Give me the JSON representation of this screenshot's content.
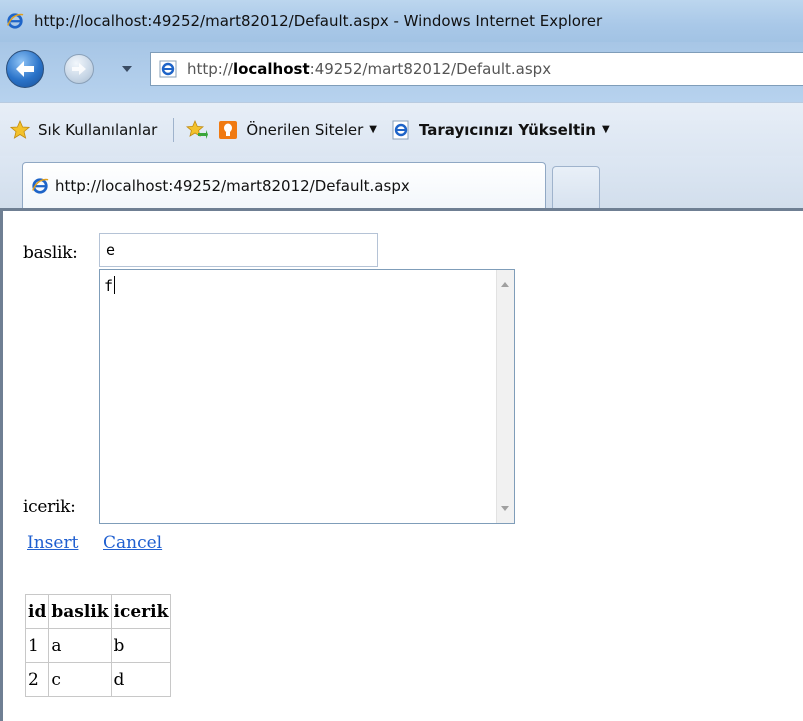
{
  "window": {
    "title": "http://localhost:49252/mart82012/Default.aspx - Windows Internet Explorer"
  },
  "address_bar": {
    "url_prefix": "http://",
    "url_host": "localhost",
    "url_rest": ":49252/mart82012/Default.aspx"
  },
  "favorites_bar": {
    "favorites_label": "Sık Kullanılanlar",
    "suggested_sites_label": "Önerilen Siteler",
    "upgrade_label": "Tarayıcınızı Yükseltin"
  },
  "tabs": {
    "active_tab_label": "http://localhost:49252/mart82012/Default.aspx"
  },
  "form": {
    "baslik_label": "baslik:",
    "baslik_value": "e",
    "icerik_label": "icerik:",
    "icerik_value": "f",
    "insert_label": "Insert",
    "cancel_label": "Cancel"
  },
  "grid": {
    "headers": [
      "id",
      "baslik",
      "icerik"
    ],
    "rows": [
      [
        "1",
        "a",
        "b"
      ],
      [
        "2",
        "c",
        "d"
      ]
    ]
  },
  "icons": {
    "ie": "ie-logo-icon",
    "back": "back-arrow-icon",
    "forward": "forward-arrow-icon",
    "favorites": "star-icon",
    "add_favorites": "add-favorite-icon",
    "suggested": "lightbulb-icon"
  },
  "colors": {
    "link": "#1f5fd0",
    "titlebar": "#a9c8e8"
  }
}
